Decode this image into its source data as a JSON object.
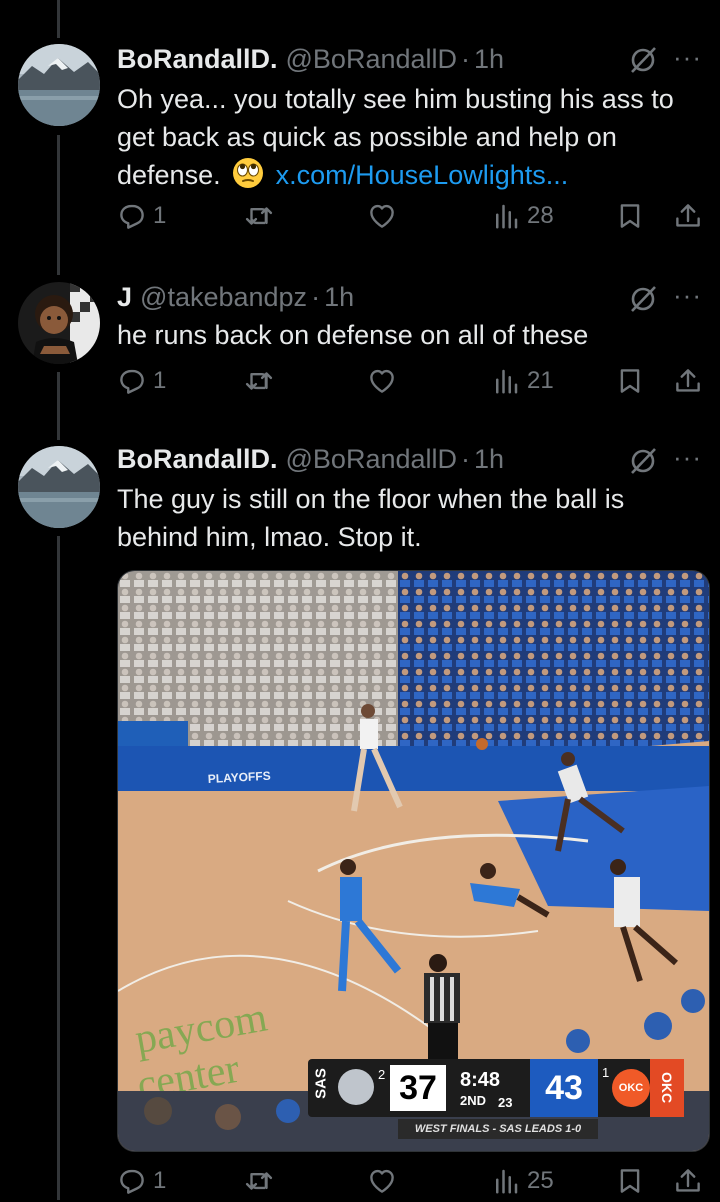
{
  "tweets": [
    {
      "name": "BoRandallD.",
      "handle": "@BoRandallD",
      "dot": "·",
      "time": "1h",
      "text_main": "Oh yea... you totally see him busting his ass to get back as quick as possible and help on defense.",
      "emoji": "face-with-rolling-eyes",
      "link": "x.com/HouseLowlights...",
      "replies": "1",
      "reposts": "",
      "likes": "",
      "views": "28"
    },
    {
      "name": "J",
      "handle": "@takebandpz",
      "dot": "·",
      "time": "1h",
      "text_main": "he runs back on defense on all of these",
      "replies": "1",
      "reposts": "",
      "likes": "",
      "views": "21"
    },
    {
      "name": "BoRandallD.",
      "handle": "@BoRandallD",
      "dot": "·",
      "time": "1h",
      "text_main": "The guy is still on the floor when the ball is behind him, lmao. Stop it.",
      "replies": "1",
      "reposts": "",
      "likes": "",
      "views": "25",
      "media": {
        "arena_text_1": "paycom",
        "arena_text_2": "center",
        "court_banner": "PLAYOFFS",
        "scorebug": {
          "away_abbr": "SAS",
          "away_timeouts": "2",
          "away_score": "37",
          "clock": "8:48",
          "period": "2ND",
          "shot_clock": "23",
          "home_score": "43",
          "home_timeouts": "1",
          "home_logo": "OKC",
          "home_abbr": "OKC",
          "series_note": "WEST FINALS - SAS LEADS 1-0"
        }
      }
    }
  ],
  "colors": {
    "background": "#000000",
    "text": "#e7e9ea",
    "muted": "#71767b",
    "link": "#1d9bf0",
    "thread_line": "#333639"
  }
}
